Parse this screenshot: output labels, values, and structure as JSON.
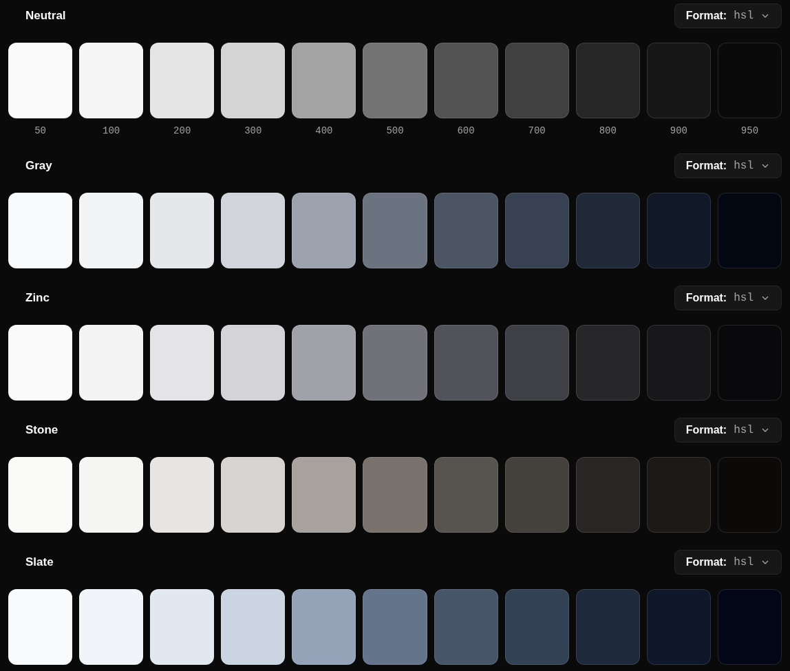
{
  "palettes": [
    {
      "name": "Neutral",
      "format_label": "Format:",
      "format_value": "hsl",
      "swatches": [
        {
          "color": "#fafafa",
          "label": "50"
        },
        {
          "color": "#f5f5f5",
          "label": "100"
        },
        {
          "color": "#e5e5e5",
          "label": "200"
        },
        {
          "color": "#d4d4d4",
          "label": "300"
        },
        {
          "color": "#a3a3a3",
          "label": "400"
        },
        {
          "color": "#737373",
          "label": "500"
        },
        {
          "color": "#525252",
          "label": "600"
        },
        {
          "color": "#404040",
          "label": "700"
        },
        {
          "color": "#262626",
          "label": "800"
        },
        {
          "color": "#171717",
          "label": "900"
        },
        {
          "color": "#0a0a0a",
          "label": "950"
        }
      ]
    },
    {
      "name": "Gray",
      "format_label": "Format:",
      "format_value": "hsl",
      "swatches": [
        {
          "color": "#f9fafb"
        },
        {
          "color": "#f3f4f6"
        },
        {
          "color": "#e5e7eb"
        },
        {
          "color": "#d1d5db"
        },
        {
          "color": "#9ca3af"
        },
        {
          "color": "#6b7280"
        },
        {
          "color": "#4b5563"
        },
        {
          "color": "#374151"
        },
        {
          "color": "#1f2937"
        },
        {
          "color": "#111827"
        },
        {
          "color": "#030712"
        }
      ]
    },
    {
      "name": "Zinc",
      "format_label": "Format:",
      "format_value": "hsl",
      "swatches": [
        {
          "color": "#fafafa"
        },
        {
          "color": "#f4f4f5"
        },
        {
          "color": "#e4e4e7"
        },
        {
          "color": "#d4d4d8"
        },
        {
          "color": "#a1a1aa"
        },
        {
          "color": "#71717a"
        },
        {
          "color": "#52525b"
        },
        {
          "color": "#3f3f46"
        },
        {
          "color": "#27272a"
        },
        {
          "color": "#18181b"
        },
        {
          "color": "#09090b"
        }
      ]
    },
    {
      "name": "Stone",
      "format_label": "Format:",
      "format_value": "hsl",
      "swatches": [
        {
          "color": "#fafaf9"
        },
        {
          "color": "#f5f5f4"
        },
        {
          "color": "#e7e5e4"
        },
        {
          "color": "#d6d3d1"
        },
        {
          "color": "#a8a29e"
        },
        {
          "color": "#78716c"
        },
        {
          "color": "#57534e"
        },
        {
          "color": "#44403c"
        },
        {
          "color": "#292524"
        },
        {
          "color": "#1c1917"
        },
        {
          "color": "#0c0a09"
        }
      ]
    },
    {
      "name": "Slate",
      "format_label": "Format:",
      "format_value": "hsl",
      "swatches": [
        {
          "color": "#f8fafc"
        },
        {
          "color": "#f1f5f9"
        },
        {
          "color": "#e2e8f0"
        },
        {
          "color": "#cbd5e1"
        },
        {
          "color": "#94a3b8"
        },
        {
          "color": "#64748b"
        },
        {
          "color": "#475569"
        },
        {
          "color": "#334155"
        },
        {
          "color": "#1e293b"
        },
        {
          "color": "#0f172a"
        },
        {
          "color": "#020617"
        }
      ]
    }
  ]
}
